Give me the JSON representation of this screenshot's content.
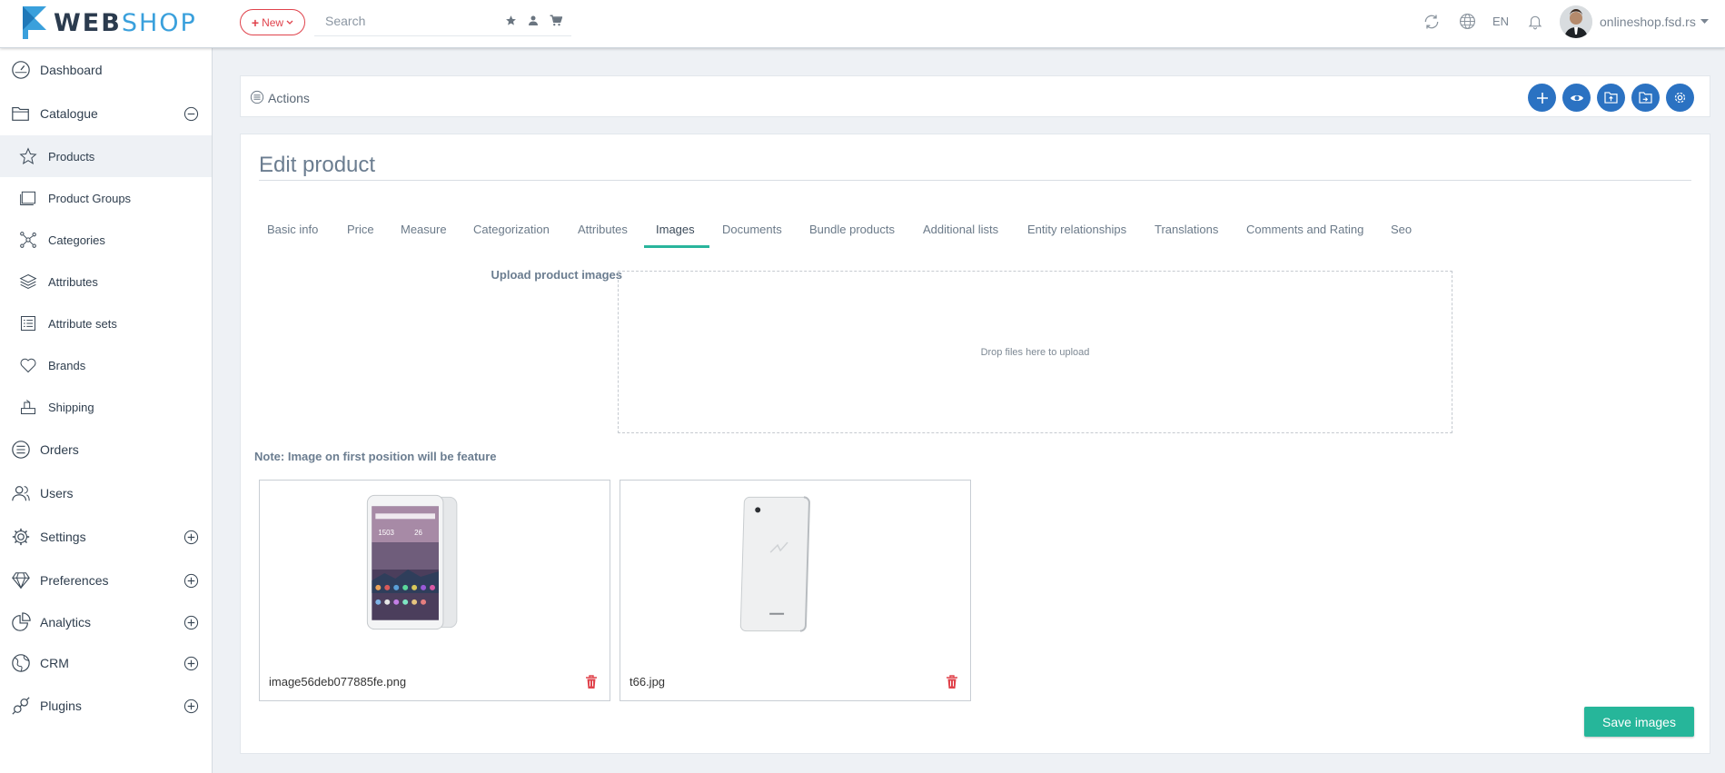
{
  "header": {
    "logo_part1": "WEB",
    "logo_part2": "SHOP",
    "new_button_label": "New",
    "search": {
      "placeholder": "Search",
      "value": ""
    },
    "language": "EN",
    "user_name": "onlineshop.fsd.rs"
  },
  "sidebar": {
    "items": [
      {
        "label": "Dashboard",
        "icon": "dashboard-icon"
      },
      {
        "label": "Catalogue",
        "icon": "folder-icon",
        "expanded": true
      },
      {
        "label": "Products",
        "icon": "star-icon",
        "active": true
      },
      {
        "label": "Product Groups",
        "icon": "product-groups-icon"
      },
      {
        "label": "Categories",
        "icon": "categories-icon"
      },
      {
        "label": "Attributes",
        "icon": "layers-icon"
      },
      {
        "label": "Attribute sets",
        "icon": "list-icon"
      },
      {
        "label": "Brands",
        "icon": "heart-icon"
      },
      {
        "label": "Shipping",
        "icon": "shipping-icon"
      },
      {
        "label": "Orders",
        "icon": "orders-icon"
      },
      {
        "label": "Users",
        "icon": "users-icon"
      },
      {
        "label": "Settings",
        "icon": "gear-icon"
      },
      {
        "label": "Preferences",
        "icon": "diamond-icon"
      },
      {
        "label": "Analytics",
        "icon": "pie-chart-icon"
      },
      {
        "label": "CRM",
        "icon": "globe-icon"
      },
      {
        "label": "Plugins",
        "icon": "plugins-icon"
      }
    ]
  },
  "actions": {
    "label": "Actions"
  },
  "page": {
    "title": "Edit product",
    "tabs": [
      "Basic info",
      "Price",
      "Measure",
      "Categorization",
      "Attributes",
      "Images",
      "Documents",
      "Bundle products",
      "Additional lists",
      "Entity relationships",
      "Translations",
      "Comments and Rating",
      "Seo"
    ],
    "selected_tab": "Images",
    "upload_label": "Upload product images",
    "drop_text": "Drop files here to upload",
    "note": "Note: Image on first position will be feature",
    "images": [
      {
        "filename": "image56deb077885fe.png"
      },
      {
        "filename": "t66.jpg"
      }
    ],
    "save_button": "Save images"
  },
  "colors": {
    "accent": "#2b72c2",
    "save": "#26b69a",
    "danger": "#e0434c",
    "logo_dark": "#2b3b4e",
    "logo_blue": "#3aa0dc"
  }
}
